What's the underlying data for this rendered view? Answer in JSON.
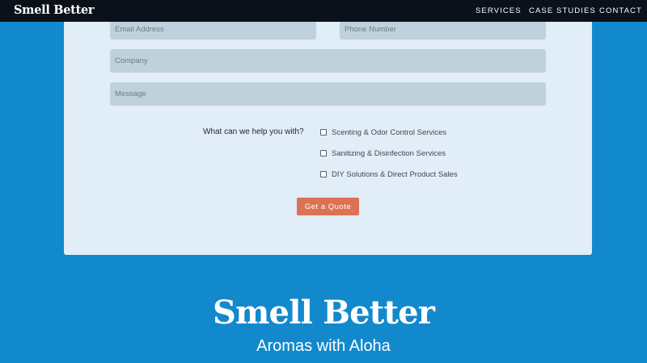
{
  "nav": {
    "brand": "Smell Better",
    "links": [
      "SERVICES",
      "CASE STUDIES",
      "CONTACT"
    ]
  },
  "form": {
    "email_placeholder": "Email Address",
    "phone_placeholder": "Phone Number",
    "company_placeholder": "Company",
    "message_placeholder": "Message",
    "question": "What can we help you with?",
    "options": [
      "Scenting & Odor Control Services",
      "Sanitizing & Disinfection Services",
      "DIY Solutions & Direct Product Sales"
    ],
    "submit_label": "Get a Quote"
  },
  "hero": {
    "title": "Smell Better",
    "tagline": "Aromas with Aloha"
  },
  "colors": {
    "page_background": "#1289cc",
    "navbar": "#0b111a",
    "form_card": "#e1edf7",
    "input_fill": "#bfd1dc",
    "button": "#db7254"
  }
}
